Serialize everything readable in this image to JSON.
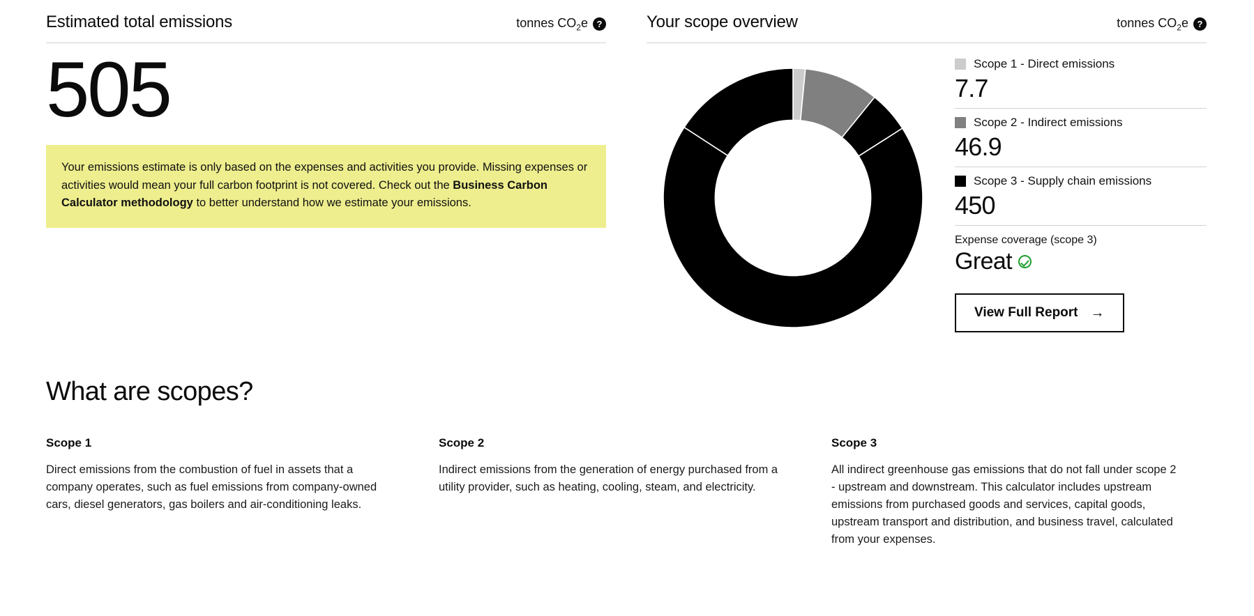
{
  "emissions_panel": {
    "title": "Estimated total emissions",
    "units": "tonnes CO",
    "units_sub": "2",
    "units_suffix": "e",
    "help_icon": "help-circle-icon",
    "help_glyph": "?",
    "total": "505",
    "callout": {
      "part1": "Your emissions estimate is only based on the expenses and activities you provide. Missing expenses or activities would mean your full carbon footprint is not covered. Check out the ",
      "link": "Business Carbon Calculator methodology",
      "part2": " to better understand how we estimate your emissions.",
      "background": "#eeee8e"
    }
  },
  "scope_panel": {
    "title": "Your scope overview",
    "units": "tonnes CO",
    "units_sub": "2",
    "units_suffix": "e",
    "help_icon": "help-circle-icon",
    "help_glyph": "?",
    "legend": [
      {
        "label": "Scope 1 - Direct emissions",
        "value": "7.7",
        "color": "#cccccc"
      },
      {
        "label": "Scope 2 - Indirect emissions",
        "value": "46.9",
        "color": "#808080"
      },
      {
        "label": "Scope 3 - Supply chain emissions",
        "value": "450",
        "color": "#000000"
      }
    ],
    "coverage_label": "Expense coverage (scope 3)",
    "coverage_value": "Great",
    "coverage_icon": "check-circle-icon",
    "coverage_color": "#1f9d2e",
    "button_label": "View Full Report",
    "button_icon": "arrow-right-icon",
    "button_glyph": "→"
  },
  "chart_data": {
    "type": "pie",
    "title": "Your scope overview",
    "units": "tonnes CO2e",
    "donut": true,
    "inner_radius_ratio": 0.6,
    "total": 504.6,
    "legend_position": "right",
    "categories": [
      "Scope 1 - Direct emissions",
      "Scope 2 - Indirect emissions",
      "Scope 3 - Supply chain emissions"
    ],
    "values": [
      7.7,
      46.9,
      450
    ],
    "colors": [
      "#cccccc",
      "#808080",
      "#000000"
    ],
    "segments": [
      {
        "name": "Scope 1 - Direct emissions",
        "value": 7.7,
        "color": "#cccccc",
        "start_deg": 0,
        "end_deg": 5.5
      },
      {
        "name": "Scope 2 - Indirect emissions",
        "value": 46.9,
        "color": "#808080",
        "start_deg": 5.5,
        "end_deg": 39
      },
      {
        "name": "Scope 3 - Supply chain emissions (segment 1)",
        "value": 26,
        "color": "#000000",
        "start_deg": 39,
        "end_deg": 57.5
      },
      {
        "name": "Scope 3 - Supply chain emissions (segment 2)",
        "value": 345,
        "color": "#000000",
        "start_deg": 57.5,
        "end_deg": 303
      },
      {
        "name": "Scope 3 - Supply chain emissions (segment 3)",
        "value": 79,
        "color": "#000000",
        "start_deg": 303,
        "end_deg": 360
      }
    ]
  },
  "scopes_section": {
    "title": "What are scopes?",
    "cards": [
      {
        "title": "Scope 1",
        "text": "Direct emissions from the combustion of fuel in assets that a company operates, such as fuel emissions from company-owned cars, diesel generators, gas boilers and air-conditioning leaks."
      },
      {
        "title": "Scope 2",
        "text": "Indirect emissions from the generation of energy purchased from a utility provider, such as heating, cooling, steam, and electricity."
      },
      {
        "title": "Scope 3",
        "text": "All indirect greenhouse gas emissions that do not fall under scope 2 - upstream and downstream. This calculator includes upstream emissions from purchased goods and services, capital goods, upstream transport and distribution, and business travel, calculated from your expenses."
      }
    ]
  }
}
